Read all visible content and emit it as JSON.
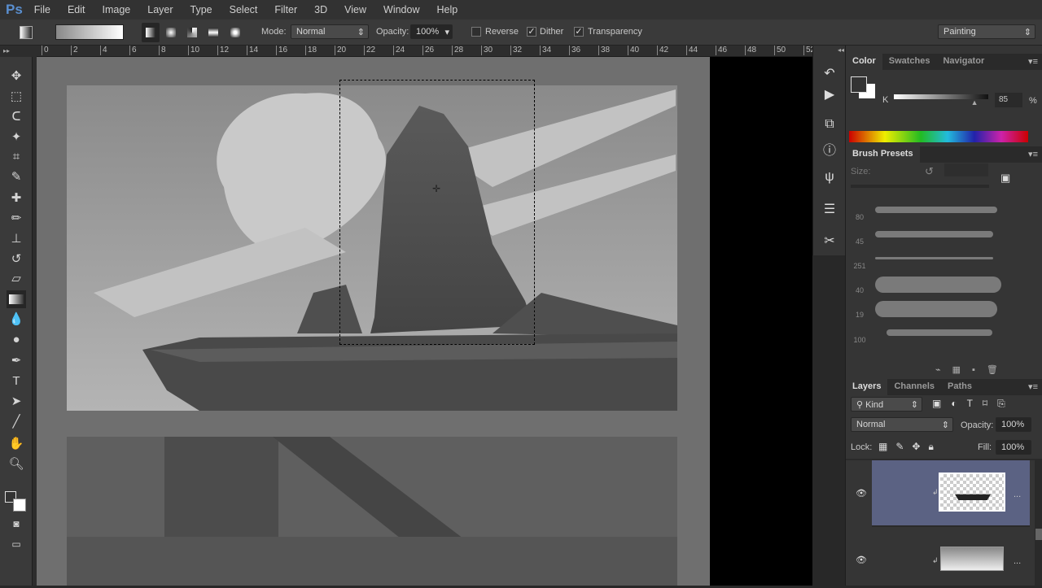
{
  "app": {
    "logo": "Ps"
  },
  "menu": [
    "File",
    "Edit",
    "Image",
    "Layer",
    "Type",
    "Select",
    "Filter",
    "3D",
    "View",
    "Window",
    "Help"
  ],
  "options": {
    "mode_label": "Mode:",
    "mode_value": "Normal",
    "opacity_label": "Opacity:",
    "opacity_value": "100%",
    "reverse_label": "Reverse",
    "reverse_checked": false,
    "dither_label": "Dither",
    "dither_checked": true,
    "transparency_label": "Transparency",
    "transparency_checked": true,
    "workspace": "Painting"
  },
  "ruler": [
    "0",
    "2",
    "4",
    "6",
    "8",
    "10",
    "12",
    "14",
    "16",
    "18",
    "20",
    "22",
    "24",
    "26",
    "28",
    "30",
    "32",
    "34",
    "36",
    "38",
    "40",
    "42",
    "44",
    "46",
    "48",
    "50",
    "52"
  ],
  "color_panel": {
    "tabs": [
      "Color",
      "Swatches",
      "Navigator"
    ],
    "channel": "K",
    "value": "85",
    "unit": "%",
    "slider_percent": 85
  },
  "brush_presets": {
    "title": "Brush Presets",
    "size_label": "Size:",
    "sizes": [
      "80",
      "45",
      "251",
      "40",
      "19",
      "100"
    ]
  },
  "layers_panel": {
    "tabs": [
      "Layers",
      "Channels",
      "Paths"
    ],
    "filter": "Kind",
    "blend_mode": "Normal",
    "opacity_label": "Opacity:",
    "opacity_value": "100%",
    "lock_label": "Lock:",
    "fill_label": "Fill:",
    "fill_value": "100%",
    "more": "..."
  },
  "colors": {
    "bg": "#282828",
    "panel": "#353535",
    "canvas": "#6f6f6f",
    "layer_selected": "#5b6283",
    "accent": "#5a8fd0"
  }
}
